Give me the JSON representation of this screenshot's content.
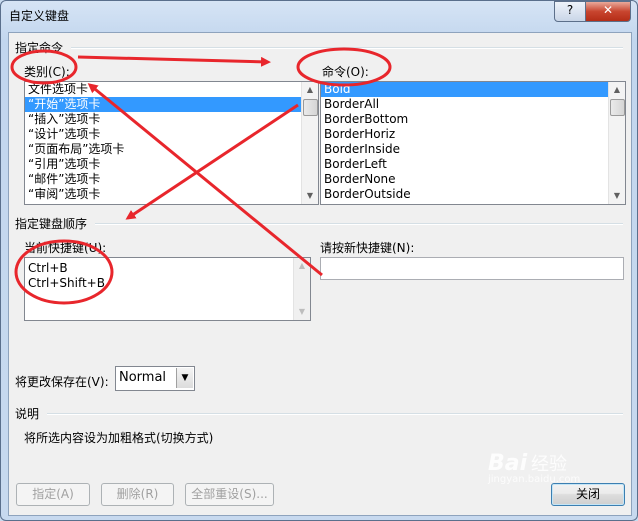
{
  "window": {
    "title": "自定义键盘",
    "help_icon": "?",
    "close_icon": "✕"
  },
  "specify_command": {
    "section_label": "指定命令",
    "categories_label": "类别(C):",
    "categories": [
      "文件选项卡",
      "“开始”选项卡",
      "“插入”选项卡",
      "“设计”选项卡",
      "“页面布局”选项卡",
      "“引用”选项卡",
      "“邮件”选项卡",
      "“审阅”选项卡"
    ],
    "selected_category": 1,
    "commands_label": "命令(O):",
    "commands": [
      "Bold",
      "BorderAll",
      "BorderBottom",
      "BorderHoriz",
      "BorderInside",
      "BorderLeft",
      "BorderNone",
      "BorderOutside"
    ],
    "selected_command": 0
  },
  "keyboard_sequence": {
    "section_label": "指定键盘顺序",
    "current_keys_label": "当前快捷键(U):",
    "current_keys": [
      "Ctrl+B",
      "Ctrl+Shift+B"
    ],
    "new_key_label": "请按新快捷键(N):",
    "new_key_value": ""
  },
  "save_in": {
    "label": "将更改保存在(V):",
    "value": "Normal"
  },
  "description": {
    "section_label": "说明",
    "text": "将所选内容设为加粗格式(切换方式)"
  },
  "buttons": {
    "assign": "指定(A)",
    "remove": "删除(R)",
    "reset_all": "全部重设(S)...",
    "close": "关闭"
  },
  "watermark": {
    "brand": "Bai",
    "brand_suffix": "经验",
    "url": "jingyan.baidu.com"
  },
  "colors": {
    "annotation": "#e8262c",
    "selection": "#3399ff"
  }
}
